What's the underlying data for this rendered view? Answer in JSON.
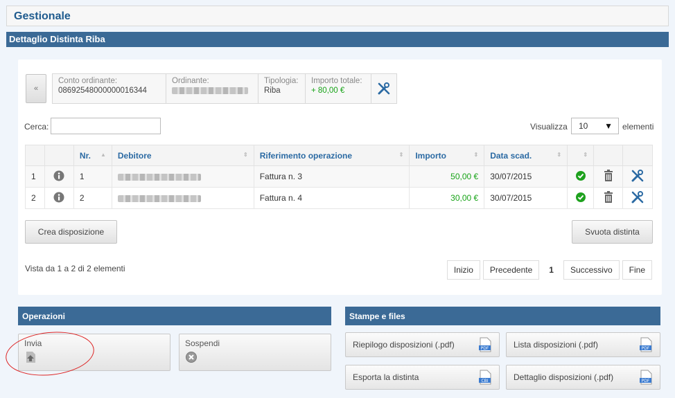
{
  "header": {
    "title": "Gestionale"
  },
  "section": {
    "title": "Dettaglio Distinta Riba"
  },
  "summary": {
    "back_label": "«",
    "conto_label": "Conto ordinante:",
    "conto_value": "08692548000000016344",
    "ordinante_label": "Ordinante:",
    "tipologia_label": "Tipologia:",
    "tipologia_value": "Riba",
    "importo_label": "Importo totale:",
    "importo_value": "+ 80,00 €"
  },
  "search": {
    "label": "Cerca:",
    "value": ""
  },
  "visualizza": {
    "label": "Visualizza",
    "selected": "10",
    "suffix": "elementi"
  },
  "table": {
    "headers": {
      "nr": "Nr.",
      "debitore": "Debitore",
      "riferimento": "Riferimento operazione",
      "importo": "Importo",
      "data": "Data scad."
    },
    "rows": [
      {
        "idx": "1",
        "nr": "1",
        "riferimento": "Fattura n. 3",
        "importo": "50,00 €",
        "data": "30/07/2015"
      },
      {
        "idx": "2",
        "nr": "2",
        "riferimento": "Fattura n. 4",
        "importo": "30,00 €",
        "data": "30/07/2015"
      }
    ]
  },
  "actions": {
    "crea": "Crea disposizione",
    "svuota": "Svuota distinta"
  },
  "footer": {
    "vista": "Vista da 1 a 2 di 2 elementi",
    "pager": {
      "inizio": "Inizio",
      "precedente": "Precedente",
      "current": "1",
      "successivo": "Successivo",
      "fine": "Fine"
    }
  },
  "operazioni": {
    "title": "Operazioni",
    "invia": "Invia",
    "sospendi": "Sospendi"
  },
  "stampe": {
    "title": "Stampe e files",
    "riepilogo": "Riepilogo disposizioni (.pdf)",
    "lista": "Lista disposizioni (.pdf)",
    "esporta": "Esporta la distinta",
    "dettaglio": "Dettaglio disposizioni (.pdf)",
    "pdf_badge": "PDF",
    "cbi_badge": "CBI"
  },
  "colors": {
    "accent": "#3b6a96",
    "link": "#2b6aa3",
    "amount": "#17a317",
    "highlight": "#dd2222"
  }
}
